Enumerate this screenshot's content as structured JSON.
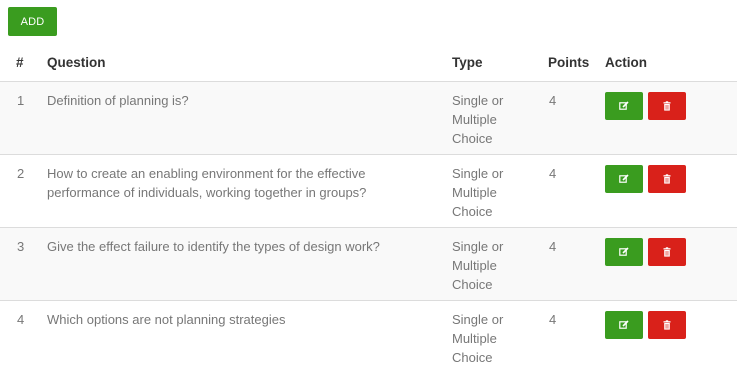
{
  "toolbar": {
    "add_label": "ADD"
  },
  "table": {
    "headers": {
      "num": "#",
      "question": "Question",
      "type": "Type",
      "points": "Points",
      "action": "Action"
    },
    "rows": [
      {
        "num": "1",
        "question": "Definition of planning is?",
        "type": "Single or Multiple Choice",
        "points": "4"
      },
      {
        "num": "2",
        "question": "How to create an enabling environment for the effective performance of individuals, working together in groups?",
        "type": "Single or Multiple Choice",
        "points": "4"
      },
      {
        "num": "3",
        "question": "Give the effect failure to identify the types of design work?",
        "type": "Single or Multiple Choice",
        "points": "4"
      },
      {
        "num": "4",
        "question": "Which options are not planning strategies",
        "type": "Single or Multiple Choice",
        "points": "4"
      }
    ]
  },
  "colors": {
    "green": "#3a9c1f",
    "red": "#d9211a"
  },
  "icons": {
    "edit": "edit-icon",
    "delete": "trash-icon"
  }
}
